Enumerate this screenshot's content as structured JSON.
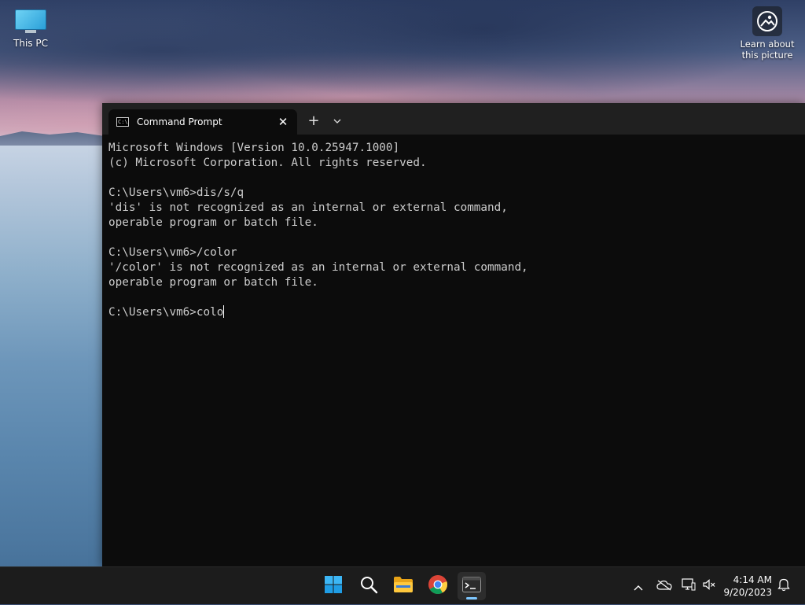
{
  "desktop": {
    "this_pc_label": "This PC",
    "learn_label_line1": "Learn about",
    "learn_label_line2": "this picture"
  },
  "terminal": {
    "tab_title": "Command Prompt",
    "close_glyph": "✕",
    "new_tab_glyph": "+",
    "dropdown_glyph": "⌄",
    "lines": [
      "Microsoft Windows [Version 10.0.25947.1000]",
      "(c) Microsoft Corporation. All rights reserved.",
      "",
      "C:\\Users\\vm6>dis/s/q",
      "'dis' is not recognized as an internal or external command,",
      "operable program or batch file.",
      "",
      "C:\\Users\\vm6>/color",
      "'/color' is not recognized as an internal or external command,",
      "operable program or batch file.",
      ""
    ],
    "current_prompt": "C:\\Users\\vm6>colo"
  },
  "taskbar": {
    "items": [
      {
        "name": "start-button",
        "icon": "windows-logo-icon"
      },
      {
        "name": "search-button",
        "icon": "search-icon"
      },
      {
        "name": "file-explorer-button",
        "icon": "folder-icon"
      },
      {
        "name": "chrome-button",
        "icon": "chrome-icon"
      },
      {
        "name": "terminal-button",
        "icon": "terminal-icon",
        "active": true
      }
    ],
    "clock_time": "4:14 AM",
    "clock_date": "9/20/2023"
  },
  "colors": {
    "terminal_bg": "#0c0c0c",
    "titlebar_bg": "#202020",
    "taskbar_bg": "#1c1c1c",
    "accent": "#7ec7ff"
  }
}
